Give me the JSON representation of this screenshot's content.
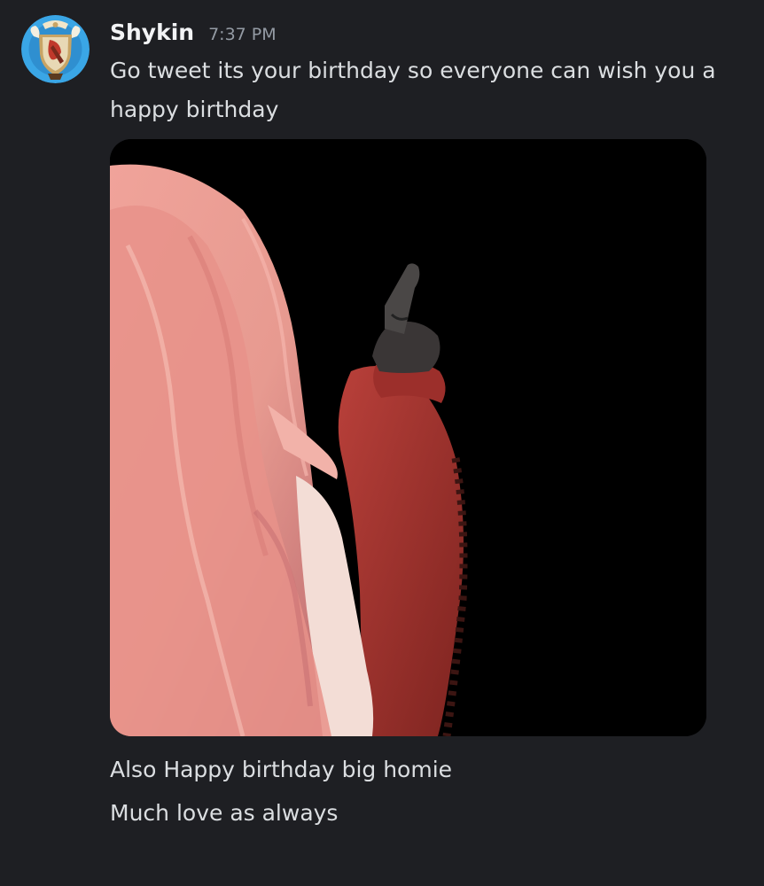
{
  "message": {
    "username": "Shykin",
    "timestamp": "7:37 PM",
    "avatar_icon": "heraldic-crest-avatar",
    "first_text": "Go tweet its your birthday so everyone can wish you a happy birthday",
    "attachment_icon": "anime-girl-holding-gun-image",
    "follow_up": [
      "Also Happy birthday big homie",
      "Much love as always"
    ]
  },
  "colors": {
    "background": "#1e1f23",
    "username": "#f2f3f5",
    "timestamp": "#949ba4",
    "text": "#dbdee1"
  }
}
